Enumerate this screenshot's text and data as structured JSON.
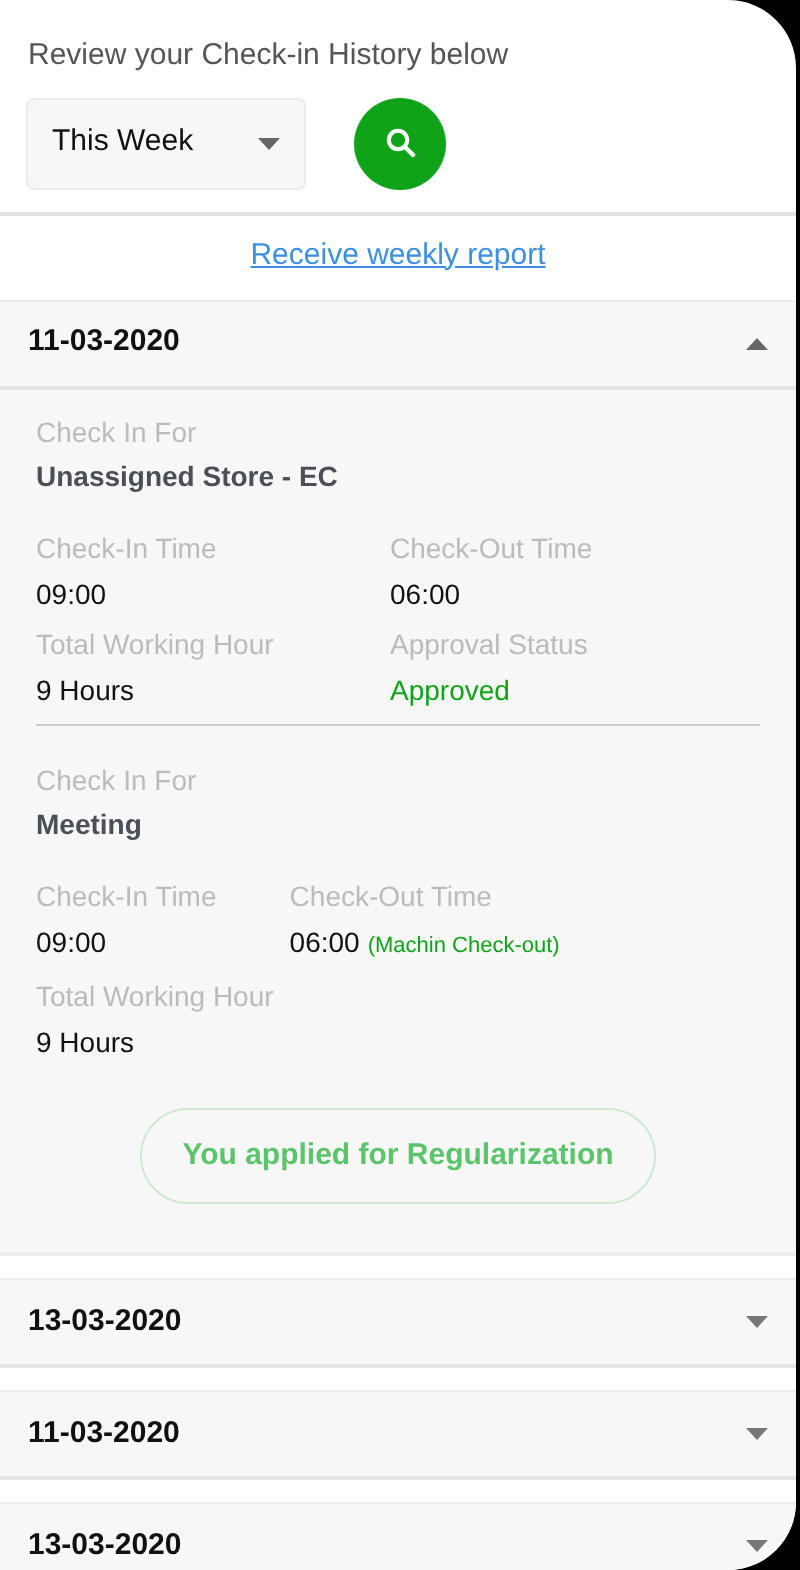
{
  "header": {
    "title": "Review your Check-in History below"
  },
  "filter": {
    "period": "This Week"
  },
  "report_link": "Receive weekly report",
  "days": [
    {
      "date": "11-03-2020",
      "expanded": true,
      "entries": [
        {
          "kind": "grid",
          "for_label": "Check In For",
          "for_value": "Unassigned Store - EC",
          "fields": [
            {
              "label": "Check-In Time",
              "value": "09:00"
            },
            {
              "label": "Check-Out Time",
              "value": "06:00"
            },
            {
              "label": "Total Working Hour",
              "value": "9 Hours"
            },
            {
              "label": "Approval Status",
              "value": "Approved",
              "kind": "status"
            }
          ]
        },
        {
          "kind": "compact",
          "for_label": "Check In For",
          "for_value": "Meeting",
          "fields": [
            {
              "label": "Check-In Time",
              "value": "09:00"
            },
            {
              "label": "Check-Out Time",
              "value": "06:00",
              "note": "(Machin Check-out)"
            },
            {
              "label": "Total Working Hour",
              "value": "9 Hours"
            }
          ]
        }
      ],
      "note": "You applied for Regularization"
    },
    {
      "date": "13-03-2020",
      "expanded": false
    },
    {
      "date": "11-03-2020",
      "expanded": false
    },
    {
      "date": "13-03-2020",
      "expanded": false
    }
  ]
}
